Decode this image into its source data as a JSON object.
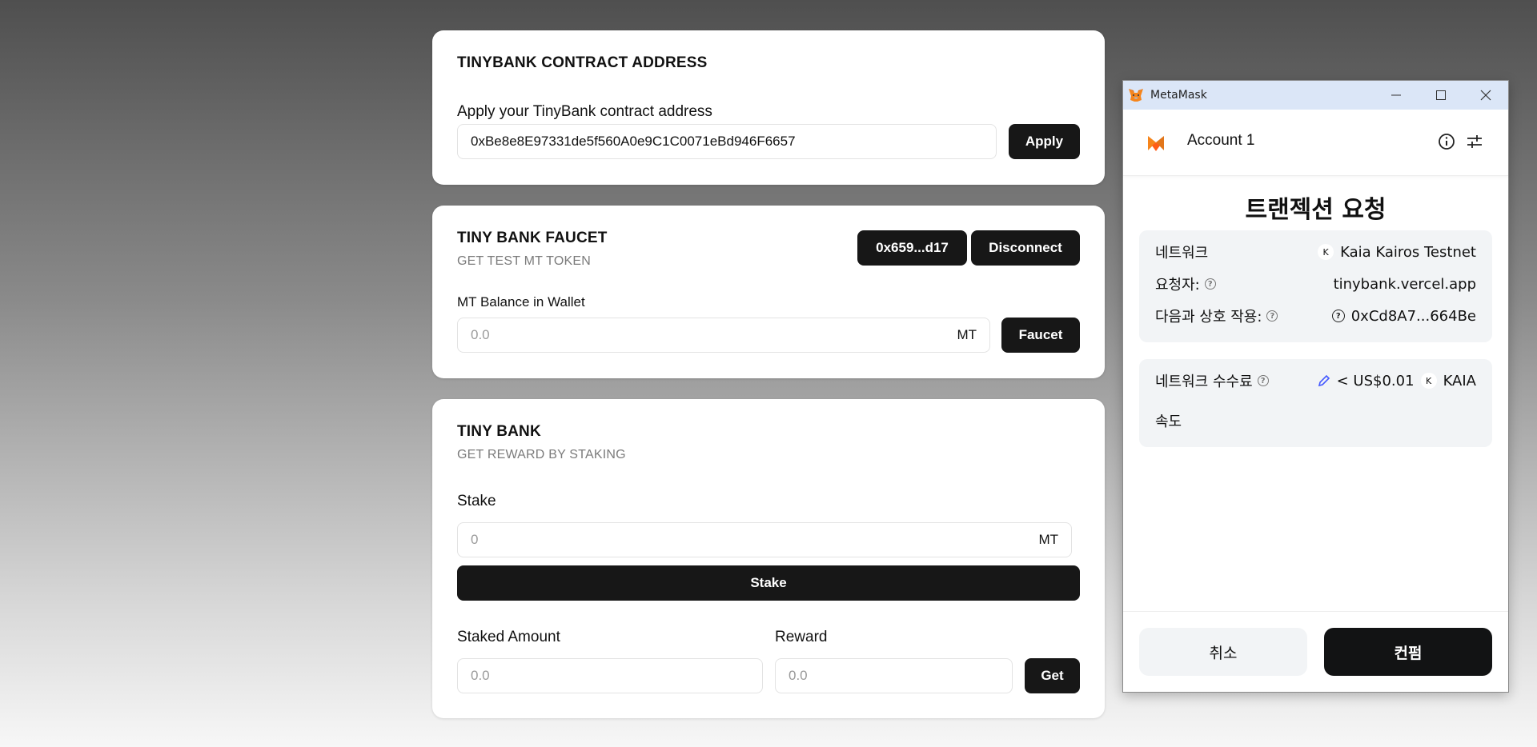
{
  "contract_card": {
    "title": "TINYBANK CONTRACT ADDRESS",
    "label": "Apply your TinyBank contract address",
    "address_value": "0xBe8e8E97331de5f560A0e9C1C0071eBd946F6657",
    "apply_label": "Apply"
  },
  "faucet_card": {
    "title": "TINY BANK FAUCET",
    "subtitle": "GET TEST MT TOKEN",
    "account_label": "0x659...d17",
    "disconnect_label": "Disconnect",
    "balance_label": "MT Balance in Wallet",
    "balance_placeholder": "0.0",
    "unit": "MT",
    "faucet_label": "Faucet"
  },
  "bank_card": {
    "title": "TINY BANK",
    "subtitle": "GET REWARD BY STAKING",
    "stake_label": "Stake",
    "stake_placeholder": "0",
    "unit": "MT",
    "stake_button": "Stake",
    "staked_amount_label": "Staked Amount",
    "staked_amount_placeholder": "0.0",
    "reward_label": "Reward",
    "reward_placeholder": "0.0",
    "get_label": "Get"
  },
  "metamask": {
    "window_title": "MetaMask",
    "account": "Account 1",
    "heading": "트랜젝션 요청",
    "network_label": "네트워크",
    "network_badge": "K",
    "network_value": "Kaia Kairos Testnet",
    "requester_label": "요청자:",
    "requester_value": "tinybank.vercel.app",
    "interact_label": "다음과 상호 작용:",
    "interact_value": "0xCd8A7...664Be",
    "fee_label": "네트워크 수수료",
    "fee_value": "< US$0.01",
    "fee_badge": "K",
    "fee_token": "KAIA",
    "speed_label": "속도",
    "cancel_label": "취소",
    "confirm_label": "컨펌",
    "accent_color": "#f6851b"
  }
}
